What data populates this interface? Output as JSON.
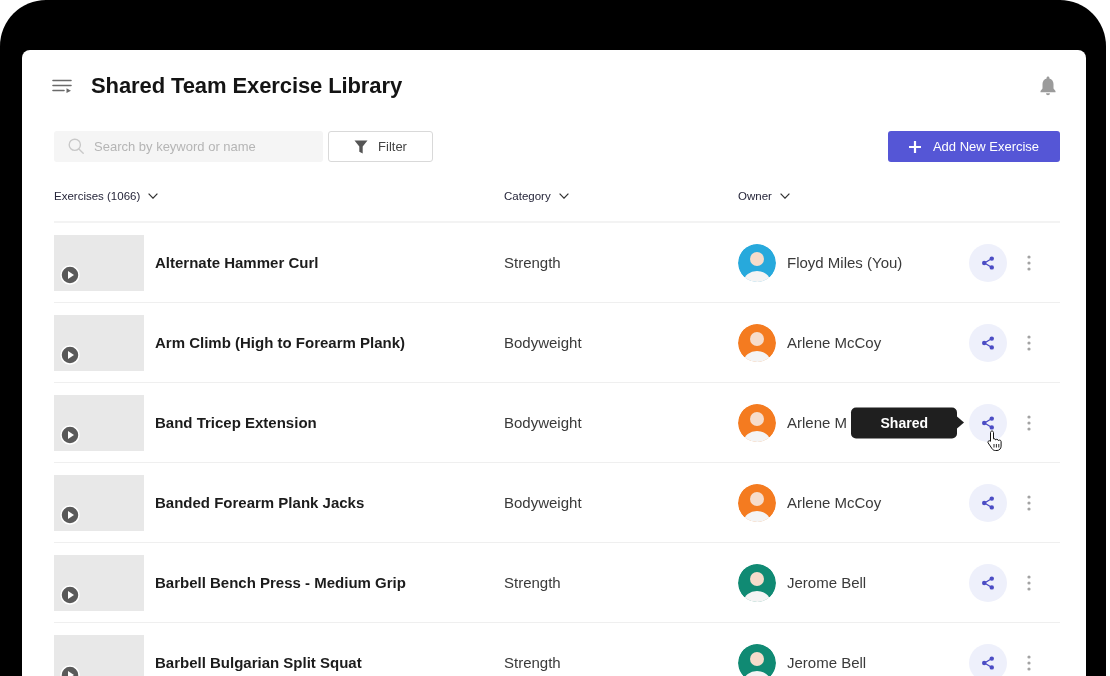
{
  "header": {
    "title": "Shared Team Exercise Library"
  },
  "toolbar": {
    "search": {
      "placeholder": "Search by keyword or name"
    },
    "filter_button": "Filter",
    "add_button": "Add New Exercise"
  },
  "table": {
    "columns": [
      "Exercises (1066)",
      "Category",
      "Owner"
    ],
    "rows": [
      {
        "name": "Alternate Hammer Curl",
        "category": "Strength",
        "owner": {
          "name": "Floyd Miles (You)",
          "color": "#27a9dc"
        }
      },
      {
        "name": "Arm Climb (High to Forearm Plank)",
        "category": "Bodyweight",
        "owner": {
          "name": "Arlene McCoy",
          "color": "#f47b20"
        }
      },
      {
        "name": "Band Tricep Extension",
        "category": "Bodyweight",
        "owner": {
          "name": "Arlene M",
          "color": "#f47b20"
        },
        "tooltip": "Shared"
      },
      {
        "name": "Banded Forearm Plank Jacks",
        "category": "Bodyweight",
        "owner": {
          "name": "Arlene McCoy",
          "color": "#f47b20"
        }
      },
      {
        "name": "Barbell Bench Press - Medium Grip",
        "category": "Strength",
        "owner": {
          "name": "Jerome Bell",
          "color": "#108a73"
        }
      },
      {
        "name": "Barbell Bulgarian Split Squat",
        "category": "Strength",
        "owner": {
          "name": "Jerome Bell",
          "color": "#108a73"
        }
      }
    ]
  }
}
